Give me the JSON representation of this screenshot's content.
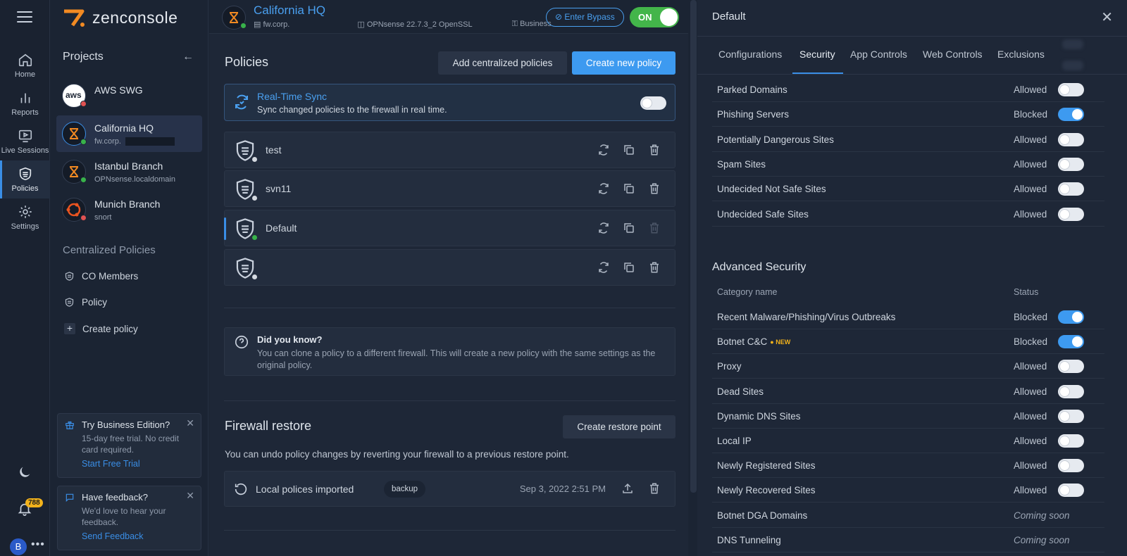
{
  "app": {
    "brand": "zenconsole",
    "accent": "#3d9af0",
    "brand_color": "#f28a22"
  },
  "rail": {
    "items": [
      {
        "label": "Home",
        "icon": "home-icon"
      },
      {
        "label": "Reports",
        "icon": "bar-chart-icon"
      },
      {
        "label": "Live Sessions",
        "icon": "monitor-play-icon"
      },
      {
        "label": "Policies",
        "icon": "shield-icon",
        "active": true
      },
      {
        "label": "Settings",
        "icon": "gear-icon"
      }
    ],
    "notifications_count": "788",
    "avatar_initial": "B"
  },
  "projects": {
    "title": "Projects",
    "items": [
      {
        "name": "AWS SWG",
        "sub": "",
        "status": "red"
      },
      {
        "name": "California HQ",
        "sub": "fw.corp.",
        "status": "green",
        "active": true
      },
      {
        "name": "Istanbul Branch",
        "sub": "OPNsense.localdomain",
        "status": "green"
      },
      {
        "name": "Munich Branch",
        "sub": "snort",
        "status": "red"
      }
    ],
    "centralized_title": "Centralized Policies",
    "centralized": [
      {
        "label": "CO Members"
      },
      {
        "label": "Policy"
      }
    ],
    "create_policy": "Create policy",
    "trial_card": {
      "title": "Try Business Edition?",
      "body": "15-day free trial. No credit card required.",
      "link": "Start Free Trial"
    },
    "feedback_card": {
      "title": "Have feedback?",
      "body": "We'd love to hear your feedback.",
      "link": "Send Feedback"
    }
  },
  "header": {
    "title": "California HQ",
    "host": "fw.corp.",
    "os": "OPNsense 22.7.3_2 OpenSSL",
    "plan": "Business",
    "bypass": "Enter Bypass",
    "switch": "ON"
  },
  "policies": {
    "title": "Policies",
    "add_centralized": "Add centralized policies",
    "create_new": "Create new policy",
    "rts_title": "Real-Time Sync",
    "rts_desc": "Sync changed policies to the firewall in real time.",
    "rows": [
      {
        "name": "test",
        "status": "grey"
      },
      {
        "name": "svn11",
        "status": "grey"
      },
      {
        "name": "Default",
        "status": "green",
        "selected": true
      },
      {
        "name": "",
        "status": "grey"
      }
    ],
    "dyk_title": "Did you know?",
    "dyk_body": "You can clone a policy to a different firewall. This will create a new policy with the same settings as the original policy."
  },
  "restore": {
    "title": "Firewall restore",
    "button": "Create restore point",
    "desc": "You can undo policy changes by reverting your firewall to a previous restore point.",
    "row": {
      "name": "Local polices imported",
      "tag": "backup",
      "date": "Sep 3, 2022 2:51 PM"
    }
  },
  "panel": {
    "title": "Default",
    "tabs": [
      "Configurations",
      "Security",
      "App Controls",
      "Web Controls",
      "Exclusions"
    ],
    "active_tab": "Security",
    "categories": [
      {
        "name": "Parked Domains",
        "status": "Allowed",
        "on": false
      },
      {
        "name": "Phishing Servers",
        "status": "Blocked",
        "on": true
      },
      {
        "name": "Potentially Dangerous Sites",
        "status": "Allowed",
        "on": false
      },
      {
        "name": "Spam Sites",
        "status": "Allowed",
        "on": false
      },
      {
        "name": "Undecided Not Safe Sites",
        "status": "Allowed",
        "on": false
      },
      {
        "name": "Undecided Safe Sites",
        "status": "Allowed",
        "on": false
      }
    ],
    "advanced_title": "Advanced Security",
    "col_category": "Category name",
    "col_status": "Status",
    "advanced": [
      {
        "name": "Recent Malware/Phishing/Virus Outbreaks",
        "status": "Blocked",
        "on": true
      },
      {
        "name": "Botnet C&C",
        "status": "Blocked",
        "on": true,
        "badge": "NEW"
      },
      {
        "name": "Proxy",
        "status": "Allowed",
        "on": false
      },
      {
        "name": "Dead Sites",
        "status": "Allowed",
        "on": false
      },
      {
        "name": "Dynamic DNS Sites",
        "status": "Allowed",
        "on": false
      },
      {
        "name": "Local IP",
        "status": "Allowed",
        "on": false
      },
      {
        "name": "Newly Registered Sites",
        "status": "Allowed",
        "on": false
      },
      {
        "name": "Newly Recovered Sites",
        "status": "Allowed",
        "on": false
      },
      {
        "name": "Botnet DGA Domains",
        "status": "Coming soon",
        "soon": true
      },
      {
        "name": "DNS Tunneling",
        "status": "Coming soon",
        "soon": true
      }
    ]
  }
}
